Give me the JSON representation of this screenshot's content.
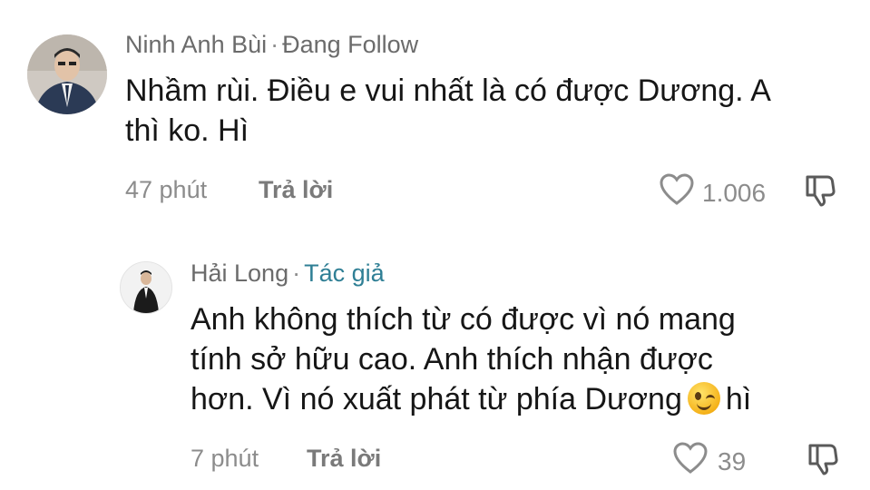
{
  "comments": [
    {
      "name": "Ninh Anh Bùi",
      "separator": "·",
      "status": "Đang Follow",
      "lines": [
        "Nhầm rùi. Điều e vui nhất là có được Dương. A",
        "thì ko. Hì"
      ],
      "time": "47 phút",
      "reply_label": "Trả lời",
      "likes": "1.006"
    },
    {
      "name": "Hải Long",
      "separator": "·",
      "status": "Tác giả",
      "lines": [
        "Anh không thích từ có được vì nó mang",
        "tính sở hữu cao. Anh thích nhận được",
        "hơn. Vì nó xuất phát từ phía Dương",
        "hì"
      ],
      "time": "7 phút",
      "reply_label": "Trả lời",
      "likes": "39"
    }
  ],
  "colors": {
    "author_tag": "#2f7f95",
    "text": "#161616",
    "muted": "#8c8c8c"
  },
  "icons": [
    "heart-icon",
    "dislike-icon",
    "winking-emoji"
  ]
}
